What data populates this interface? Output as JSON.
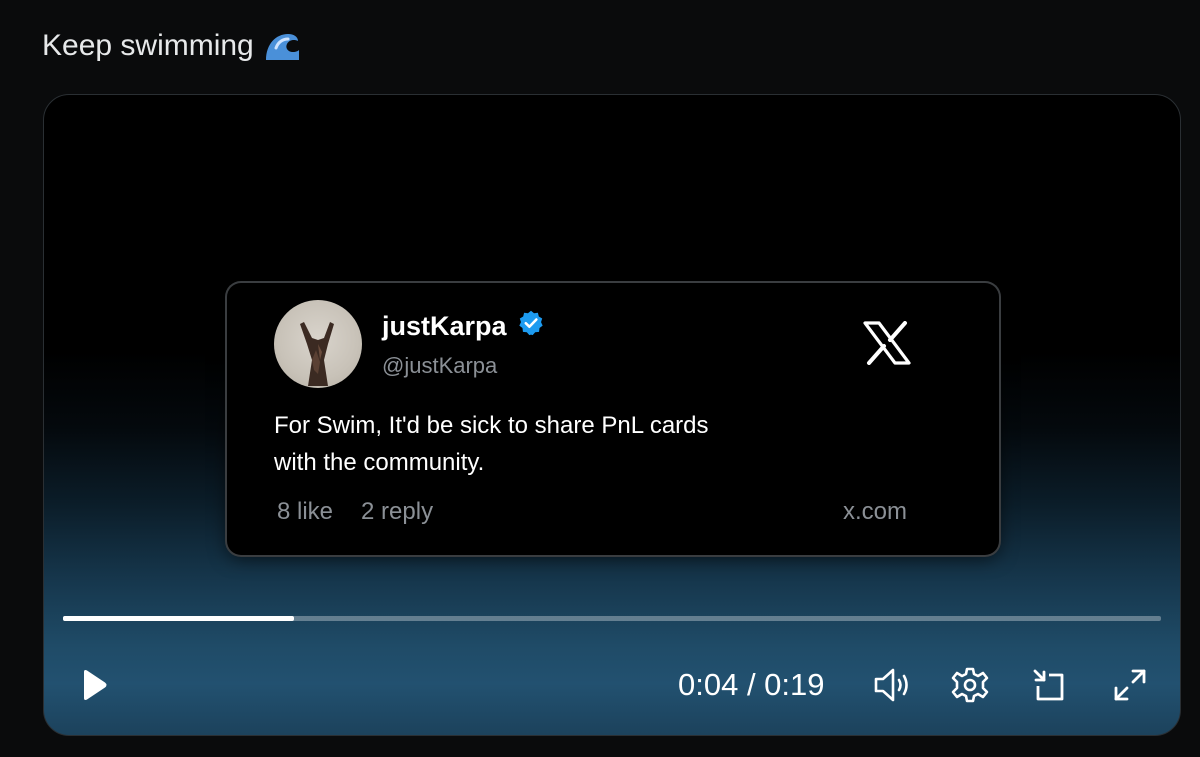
{
  "post": {
    "text": "Keep swimming",
    "emoji_icon": "water-wave-icon"
  },
  "tweet": {
    "author_name": "justKarpa",
    "verified_icon": "verified-badge-icon",
    "handle": "@justKarpa",
    "logo_icon": "x-logo-icon",
    "body_line1": "For Swim, It'd be sick to share PnL cards",
    "body_line2": "with the community.",
    "likes": "8 like",
    "replies": "2 reply",
    "domain": "x.com"
  },
  "player": {
    "current_time": "0:04",
    "separator": "/",
    "duration": "0:19",
    "time_display": "0:04 / 0:19",
    "progress_fraction": 0.21,
    "icons": [
      "play-icon",
      "volume-icon",
      "settings-gear-icon",
      "pip-icon",
      "fullscreen-icon"
    ]
  },
  "colors": {
    "background": "#0a0b0c",
    "verified_blue": "#1d9bf0",
    "video_gradient_bottom": "#225170",
    "muted_text": "#8b9096"
  }
}
